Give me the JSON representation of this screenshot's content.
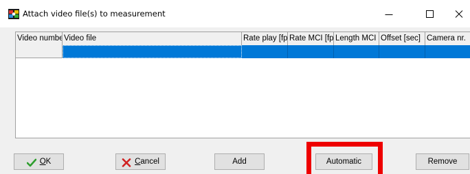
{
  "window": {
    "title": "Attach video file(s) to measurement",
    "icon": "camera-icon",
    "controls": {
      "minimize_icon": "minimize-icon",
      "maximize_icon": "maximize-icon",
      "close_icon": "close-icon"
    }
  },
  "grid": {
    "columns": [
      "Video number",
      "Video file",
      "Rate play [fps",
      "Rate MCI [fps",
      "Length MCI [s",
      "Offset [sec]",
      "Camera nr."
    ],
    "rows": [
      [
        "",
        "",
        "",
        "",
        "",
        "",
        ""
      ]
    ],
    "selection_color": "#0078d7"
  },
  "buttons": {
    "ok": {
      "label_prefix": "",
      "label_mnemonic": "O",
      "label_rest": "K",
      "icon": "checkmark-icon",
      "icon_color": "#2e9e2e"
    },
    "cancel": {
      "label_mnemonic": "C",
      "label_rest": "ancel",
      "icon": "x-icon",
      "icon_color": "#d02020"
    },
    "add": {
      "label": "Add"
    },
    "automatic": {
      "label": "Automatic"
    },
    "remove": {
      "label": "Remove"
    }
  },
  "annotation": {
    "highlight_color": "#ee0000",
    "target": "automatic-button"
  }
}
